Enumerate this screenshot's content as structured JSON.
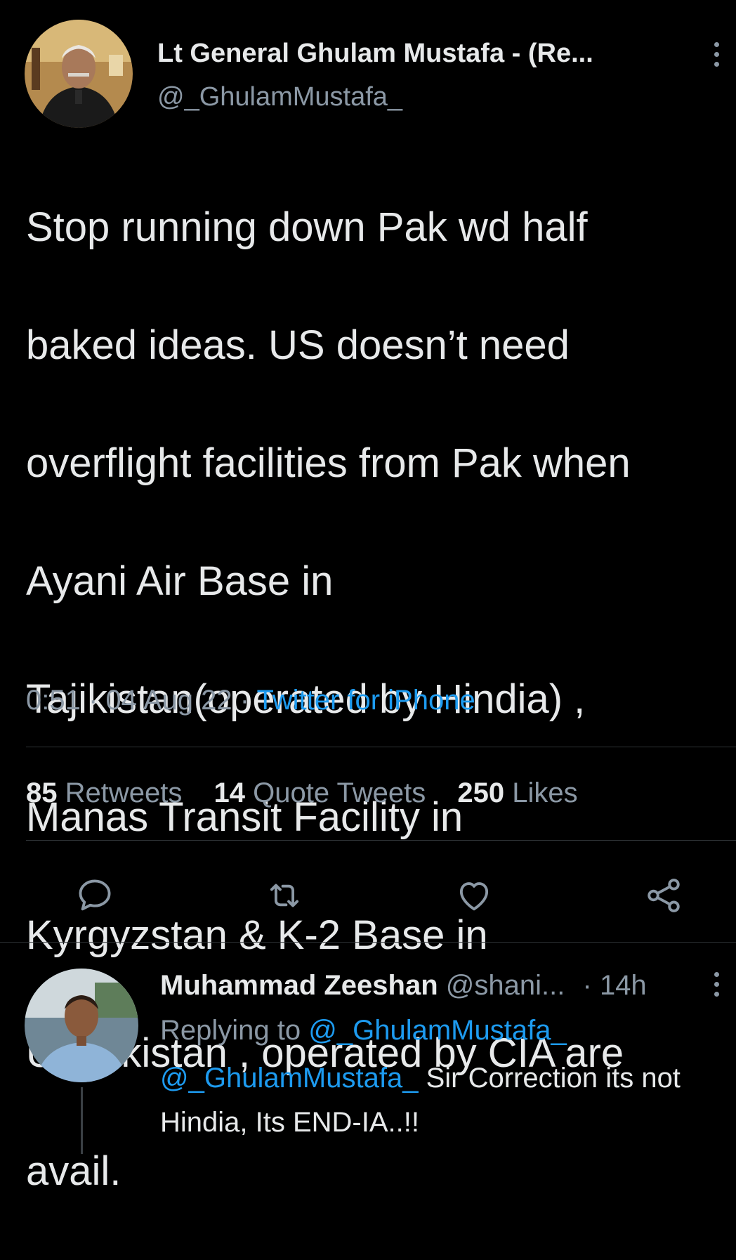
{
  "tweet": {
    "author_name": "Lt General Ghulam Mustafa - (Re...",
    "author_handle": "@_GhulamMustafa_",
    "text_lines": [
      "Stop running down Pak wd half",
      "baked ideas. US doesn’t need",
      "overflight facilities from Pak when",
      "Ayani Air Base  in",
      "Tajikistan(operated by Hindia) ,",
      "Manas Transit Facility in",
      "Kyrgyzstan & K-2 Base in",
      "Uzbekistan , operated by CIA are",
      "avail."
    ],
    "time": "0:51",
    "date": "04 Aug 22",
    "separator": "·",
    "source": "Twitter for iPhone"
  },
  "stats": {
    "retweets_count": "85",
    "retweets_label": "Retweets",
    "quotes_count": "14",
    "quotes_label": "Quote Tweets",
    "likes_count": "250",
    "likes_label": "Likes"
  },
  "actions": {
    "reply_icon": "reply-icon",
    "retweet_icon": "retweet-icon",
    "like_icon": "heart-icon",
    "share_icon": "share-icon"
  },
  "reply": {
    "author_name": "Muhammad Zeeshan",
    "author_handle": "@shani...",
    "separator": "·",
    "time": "14h",
    "replying_prefix": "Replying to",
    "replying_handle": "@_GhulamMustafa_",
    "mention": "@_GhulamMustafa_",
    "text_line1": "Sir Correction its not",
    "text_line2": "Hindia, Its END-IA..!!"
  },
  "colors": {
    "background": "#000000",
    "text": "#e7e9ea",
    "secondary": "#8b98a5",
    "accent": "#1d9bf0",
    "divider": "#2f3336"
  }
}
